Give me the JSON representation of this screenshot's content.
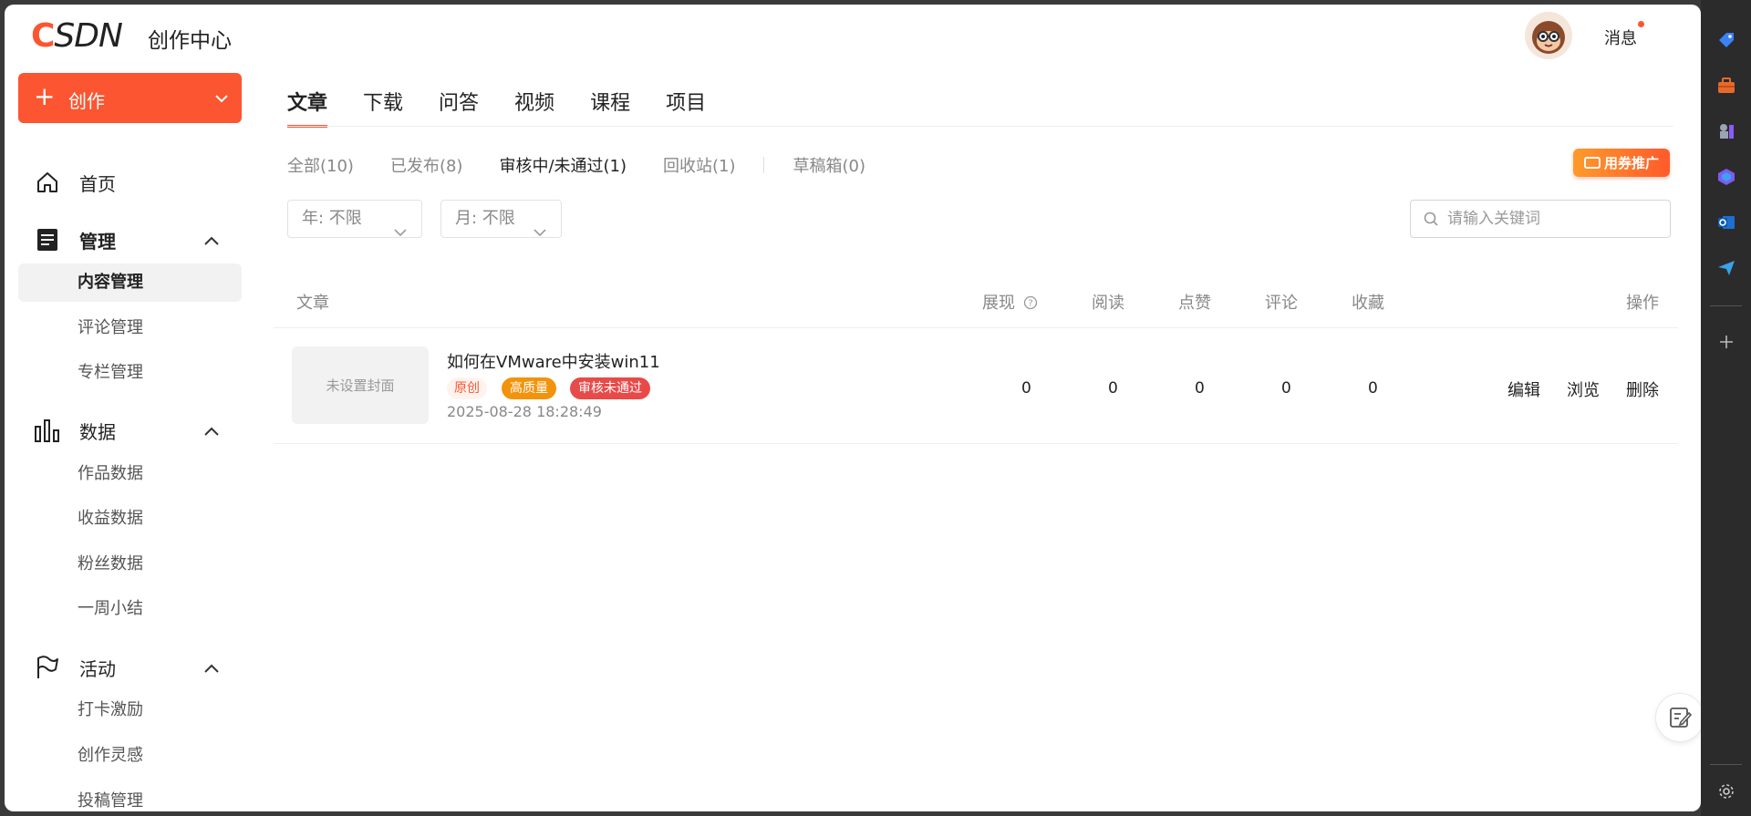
{
  "header": {
    "logo_c": "C",
    "logo_rest": "SDN",
    "brand_sub": "创作中心",
    "messages_label": "消息"
  },
  "sidebar": {
    "create_label": "创作",
    "home": "首页",
    "manage": {
      "label": "管理",
      "items": [
        "内容管理",
        "评论管理",
        "专栏管理"
      ]
    },
    "data": {
      "label": "数据",
      "items": [
        "作品数据",
        "收益数据",
        "粉丝数据",
        "一周小结"
      ]
    },
    "activity": {
      "label": "活动",
      "items": [
        "打卡激励",
        "创作灵感",
        "投稿管理"
      ]
    }
  },
  "tabs": [
    "文章",
    "下载",
    "问答",
    "视频",
    "课程",
    "项目"
  ],
  "subtabs": [
    "全部(10)",
    "已发布(8)",
    "审核中/未通过(1)",
    "回收站(1)",
    "草稿箱(0)"
  ],
  "promo_label": "用券推广",
  "filters": {
    "year": "年:  不限",
    "month": "月:  不限"
  },
  "search": {
    "placeholder": "请输入关键词"
  },
  "table": {
    "headers": {
      "article": "文章",
      "views": "展现",
      "reads": "阅读",
      "likes": "点赞",
      "comments": "评论",
      "favorites": "收藏",
      "actions": "操作"
    },
    "rows": [
      {
        "cover_placeholder": "未设置封面",
        "title": "如何在VMware中安装win11",
        "tags": [
          "原创",
          "高质量",
          "审核未通过"
        ],
        "date": "2025-08-28 18:28:49",
        "views": "0",
        "reads": "0",
        "likes": "0",
        "comments": "0",
        "favorites": "0",
        "actions": [
          "编辑",
          "浏览",
          "删除"
        ]
      }
    ]
  },
  "colors": {
    "accent": "#fc5531",
    "tag_hq": "#f2930b",
    "tag_rejected": "#e84a4a"
  }
}
